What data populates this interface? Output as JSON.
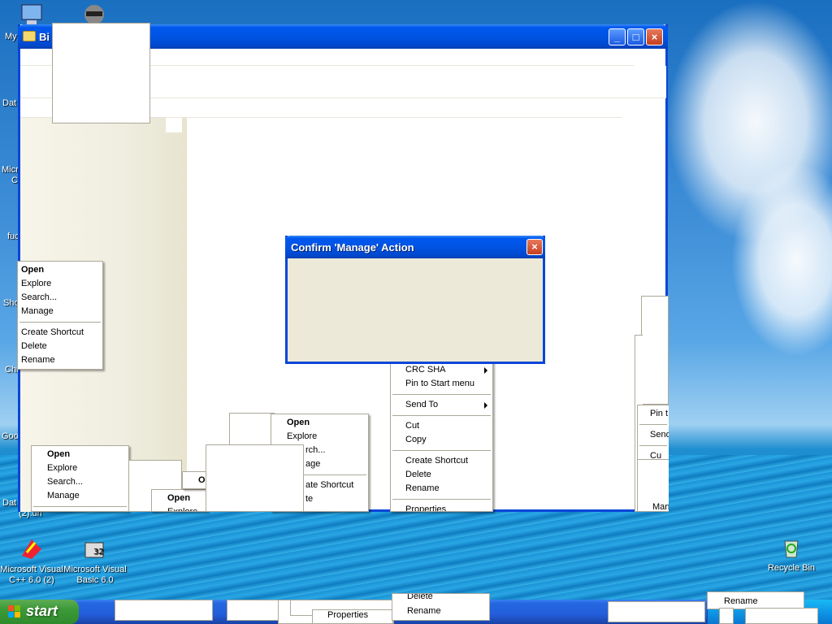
{
  "desktop": {
    "icons": [
      {
        "label": "My"
      },
      {
        "label": "Dat"
      },
      {
        "label": "Micro"
      },
      {
        "label": "C"
      },
      {
        "label": "fuc"
      },
      {
        "label": "Sho"
      },
      {
        "label": "Chr"
      },
      {
        "label": "Goo"
      },
      {
        "label": "Dat"
      },
      {
        "label": "(2).url"
      },
      {
        "label": "Microsoft Visual C++ 6.0 (2)"
      },
      {
        "label": "Microsoft Visual Basic 6.0"
      },
      {
        "label": "Recycle Bin"
      }
    ]
  },
  "window": {
    "title": "Bi"
  },
  "dialog": {
    "title": "Confirm 'Manage' Action",
    "close": "×"
  },
  "menus": {
    "left": [
      "Open",
      "Explore",
      "Search...",
      "Manage",
      "Create Shortcut",
      "Delete",
      "Rename"
    ],
    "bottom_left": [
      "Open",
      "Explore",
      "Search...",
      "Manage"
    ],
    "small_open": [
      "Open",
      "Explore"
    ],
    "small_o": [
      "O"
    ],
    "center": [
      "Open",
      "Explore",
      "rch...",
      "age",
      "ate Shortcut",
      "te"
    ],
    "right": {
      "items": [
        "CRC SHA",
        "Pin to Start menu",
        "Send To",
        "Cut",
        "Copy",
        "Create Shortcut",
        "Delete",
        "Rename",
        "Properties"
      ]
    },
    "far_right": [
      "Pin t",
      "Send",
      "Cu",
      "Man"
    ]
  },
  "taskbar": {
    "start": "start",
    "items": [
      "Properties",
      "Rename",
      "Rename",
      "Delete"
    ]
  },
  "colors": {
    "xp_blue": "#0054e3",
    "dialog_bg": "#ece9d8",
    "start_green": "#3c9a37"
  }
}
